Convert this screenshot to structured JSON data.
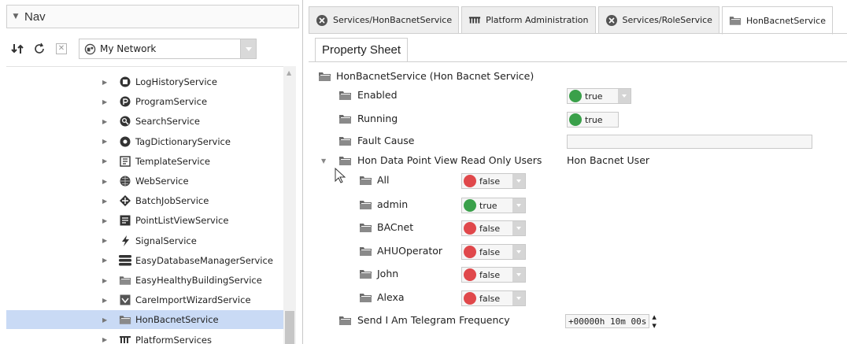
{
  "nav": {
    "title": "Nav",
    "network_selector": "My Network",
    "tree": [
      {
        "label": "LogHistoryService",
        "icon": "log-history-icon"
      },
      {
        "label": "ProgramService",
        "icon": "program-icon"
      },
      {
        "label": "SearchService",
        "icon": "search-icon"
      },
      {
        "label": "TagDictionaryService",
        "icon": "tag-icon"
      },
      {
        "label": "TemplateService",
        "icon": "template-icon"
      },
      {
        "label": "WebService",
        "icon": "globe-icon"
      },
      {
        "label": "BatchJobService",
        "icon": "batch-job-icon"
      },
      {
        "label": "PointListViewService",
        "icon": "list-icon"
      },
      {
        "label": "SignalService",
        "icon": "signal-icon"
      },
      {
        "label": "EasyDatabaseManagerService",
        "icon": "database-icon"
      },
      {
        "label": "EasyHealthyBuildingService",
        "icon": "folder-icon"
      },
      {
        "label": "CareImportWizardService",
        "icon": "wizard-icon"
      },
      {
        "label": "HonBacnetService",
        "icon": "folder-icon",
        "selected": true
      },
      {
        "label": "PlatformServices",
        "icon": "platform-icon"
      }
    ]
  },
  "tabs": [
    {
      "label": "Services/HonBacnetService",
      "icon": "close-circle-icon"
    },
    {
      "label": "Platform Administration",
      "icon": "platform-icon"
    },
    {
      "label": "Services/RoleService",
      "icon": "close-circle-icon"
    },
    {
      "label": "HonBacnetService",
      "icon": "folder-icon",
      "active": true
    }
  ],
  "subtab": "Property Sheet",
  "sheet": {
    "root": "HonBacnetService  (Hon Bacnet Service)",
    "enabled": {
      "name": "Enabled",
      "value": "true"
    },
    "running": {
      "name": "Running",
      "value": "true"
    },
    "fault_cause": {
      "name": "Fault Cause",
      "value": ""
    },
    "users_group": {
      "name": "Hon Data Point View Read Only Users",
      "value": "Hon Bacnet User"
    },
    "users": [
      {
        "name": "All",
        "value": "false"
      },
      {
        "name": "admin",
        "value": "true"
      },
      {
        "name": "BACnet",
        "value": "false"
      },
      {
        "name": "AHUOperator",
        "value": "false"
      },
      {
        "name": "John",
        "value": "false"
      },
      {
        "name": "Alexa",
        "value": "false"
      }
    ],
    "telegram": {
      "name": "Send I Am Telegram Frequency",
      "value": "+00000h 10m 00s"
    }
  },
  "colors": {
    "true": "#3aa04a",
    "false": "#e0484b",
    "selection": "#c9daf5"
  }
}
